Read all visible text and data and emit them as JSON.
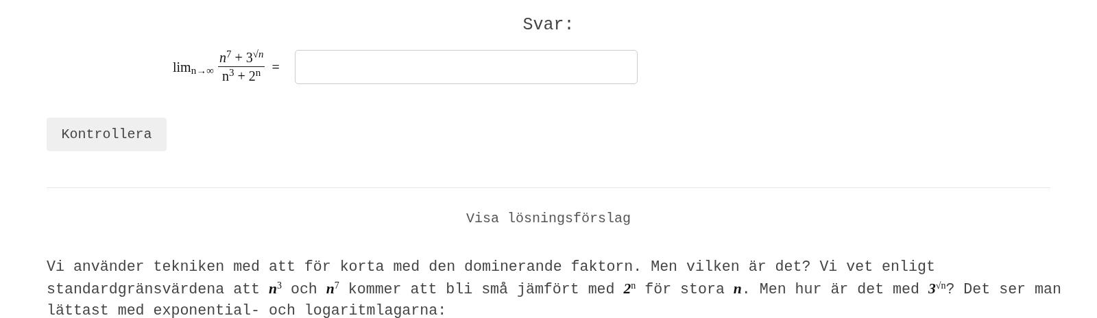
{
  "answer_heading": "Svar:",
  "formula": {
    "operator": "lim",
    "subscript": "n→∞",
    "numerator": "n$^{7}$ + 3$^{√n}$",
    "denominator": "n$^{3}$ + 2$^{n}$",
    "equals": "="
  },
  "check_button": "Kontrollera",
  "solution_toggle": "Visa lösningsförslag",
  "solution_text": "Vi använder tekniken med att för korta med den dominerande faktorn. Men vilken är det? Vi vet enligt standardgränsvärdena att **n**$^{3}$ och **n**$^{7}$ kommer att bli små jämfört med **2**$^{n}$ för stora **n**. Men hur är det med **3**$^{√n}$? Det ser man lättast med exponential- och logaritmlagarna:"
}
